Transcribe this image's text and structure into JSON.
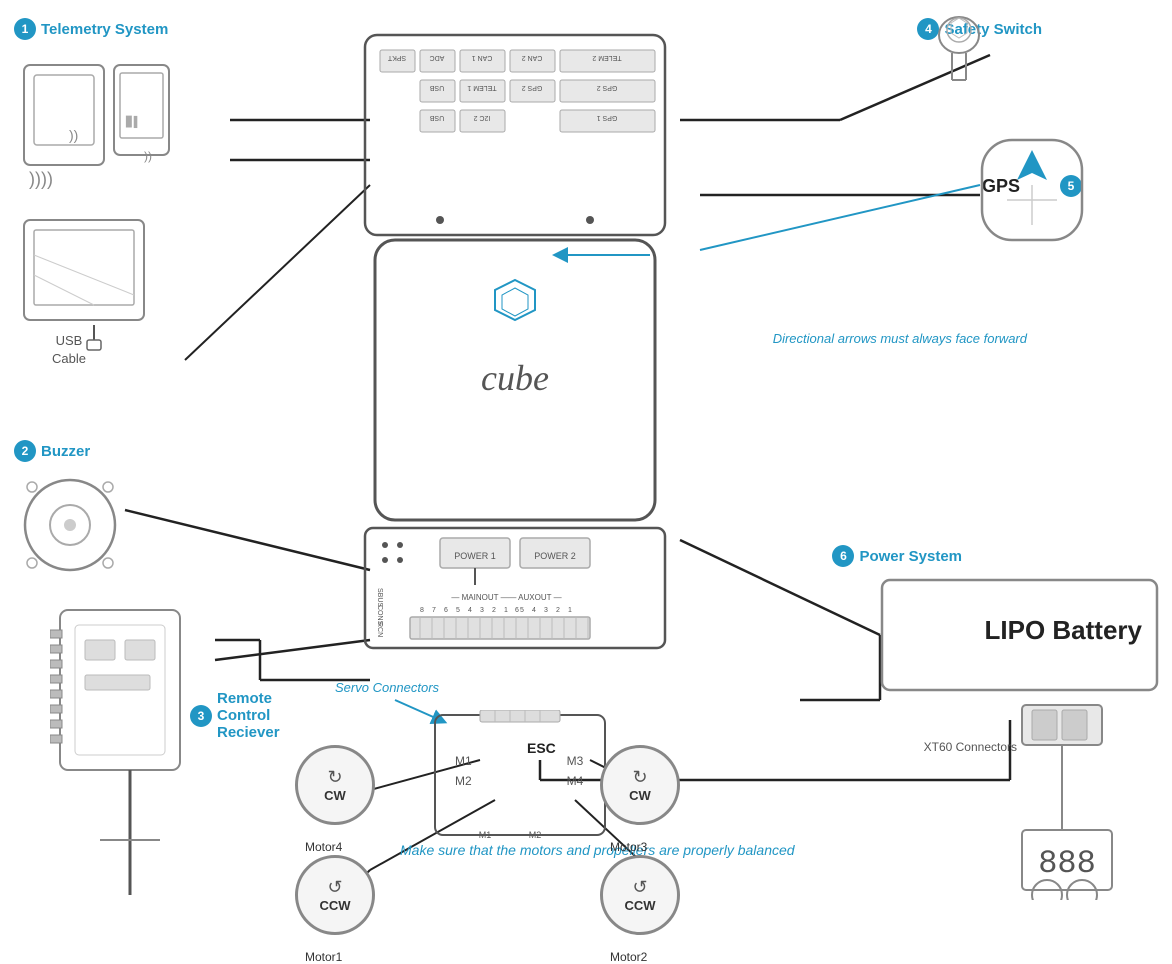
{
  "labels": {
    "badge1": "1",
    "badge2": "2",
    "badge3": "3",
    "badge4": "4",
    "badge5": "5",
    "badge6": "6",
    "telemetry": "Telemetry System",
    "buzzer": "Buzzer",
    "rc": "Remote\nControl\nReciever",
    "safety": "Safety\nSwitch",
    "gps": "GPS",
    "power": "Power System",
    "lipo": "LIPO Battery",
    "esc": "ESC",
    "xt60": "XT60\nConnectors"
  },
  "annotations": {
    "directional": "Directional arrows\nmust always face\nforward",
    "servo": "Servo\nConnectors",
    "balance": "Make sure that the\nmotors and propellers are\nproperly balanced"
  },
  "motors": {
    "m4": {
      "dir": "CW",
      "label": "Motor4"
    },
    "m3": {
      "dir": "CW",
      "label": "Motor3"
    },
    "m1": {
      "dir": "CCW",
      "label": "Motor1"
    },
    "m2": {
      "dir": "CCW",
      "label": "Motor2"
    }
  },
  "cube": {
    "brand": "cube",
    "ports": {
      "top_row": [
        "SPKT",
        "ADC",
        "CAN 1",
        "CAN 2",
        "TELEM 2"
      ],
      "mid_row": [
        "USB",
        "TELEM 1",
        "GPS 2",
        "GPS 2"
      ],
      "bot_row": [
        "USB",
        "I2C 2",
        "GPS 1"
      ],
      "power": [
        "POWER 1",
        "POWER 2"
      ],
      "output_labels": [
        "MAINOUT",
        "AUXOUT"
      ],
      "side_labels": [
        "SBUS",
        "CONS",
        "RCN"
      ]
    }
  }
}
